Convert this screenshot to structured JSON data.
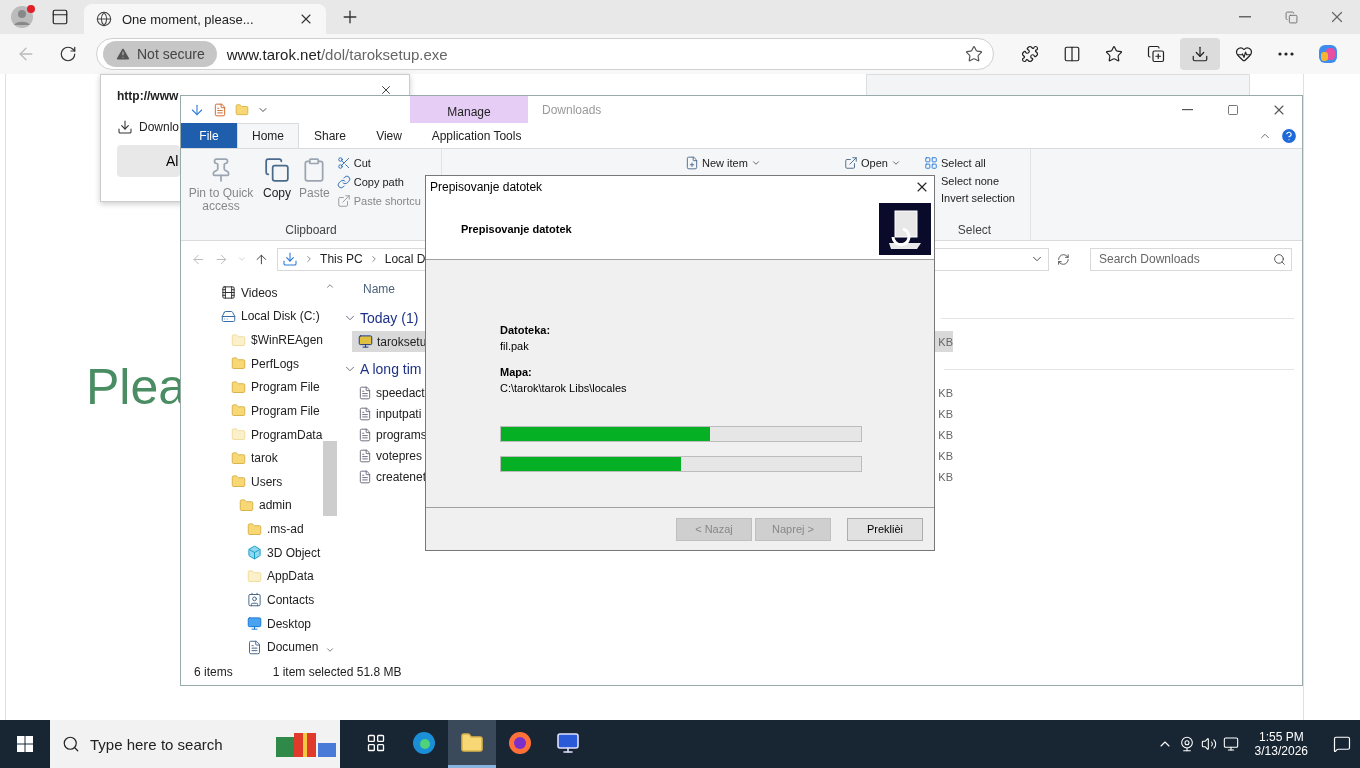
{
  "browser": {
    "tab_title": "One moment, please...",
    "security": "Not secure",
    "url_host": "www.tarok.net",
    "url_path": "/dol/taroksetup.exe",
    "page_heading": "Plea",
    "download_prompt": {
      "title": "http://www",
      "item": "Downlo",
      "button": "Al"
    }
  },
  "explorer": {
    "title": "Downloads",
    "context_tab": "Manage",
    "tabs": [
      {
        "label": "File",
        "kind": "file",
        "selected": false
      },
      {
        "label": "Home",
        "kind": "plain",
        "selected": true
      },
      {
        "label": "Share",
        "kind": "plain",
        "selected": false
      },
      {
        "label": "View",
        "kind": "plain",
        "selected": false
      },
      {
        "label": "Application Tools",
        "kind": "context",
        "selected": false
      }
    ],
    "clipboard": {
      "label": "Clipboard",
      "large": [
        {
          "label": "Pin to Quick access",
          "kind": "pin",
          "disabled": true
        },
        {
          "label": "Copy",
          "kind": "copy",
          "disabled": false
        },
        {
          "label": "Paste",
          "kind": "paste",
          "disabled": true
        }
      ],
      "small": [
        {
          "label": "Cut",
          "kind": "cut",
          "disabled": false
        },
        {
          "label": "Copy path",
          "kind": "path",
          "disabled": false
        },
        {
          "label": "Paste shortcu",
          "kind": "shortcut",
          "disabled": true
        }
      ]
    },
    "new_item": "New item",
    "open": "Open",
    "select": {
      "label": "Select",
      "items": [
        "Select all",
        "Select none",
        "Invert selection"
      ]
    },
    "path": [
      "This PC",
      "Local D"
    ],
    "search": {
      "placeholder": "Search Downloads"
    },
    "nav": [
      {
        "label": "Videos",
        "kind": "videos"
      },
      {
        "label": "Local Disk (C:)",
        "kind": "drive",
        "children": [
          {
            "label": "$WinREAgen",
            "kind": "faded"
          },
          {
            "label": "PerfLogs",
            "kind": "folder"
          },
          {
            "label": "Program File",
            "kind": "folder"
          },
          {
            "label": "Program File",
            "kind": "folder"
          },
          {
            "label": "ProgramData",
            "kind": "faded"
          },
          {
            "label": "tarok",
            "kind": "folder"
          },
          {
            "label": "Users",
            "kind": "folder",
            "children": [
              {
                "label": "admin",
                "kind": "folder",
                "children": [
                  {
                    "label": ".ms-ad",
                    "kind": "folder"
                  },
                  {
                    "label": "3D Object",
                    "kind": "cube"
                  },
                  {
                    "label": "AppData",
                    "kind": "faded"
                  },
                  {
                    "label": "Contacts",
                    "kind": "contacts"
                  },
                  {
                    "label": "Desktop",
                    "kind": "desktop"
                  },
                  {
                    "label": "Documen",
                    "kind": "document"
                  }
                ]
              }
            ]
          }
        ]
      }
    ],
    "column": "Name",
    "groups": [
      {
        "label": "Today (1)",
        "files": [
          {
            "name": "taroksetu",
            "size": "KB",
            "kind": "app",
            "selected": true
          }
        ]
      },
      {
        "label": "A long tim",
        "files": [
          {
            "name": "speedact",
            "size": "KB",
            "kind": "doc",
            "selected": false
          },
          {
            "name": "inputpati",
            "size": "KB",
            "kind": "doc",
            "selected": false
          },
          {
            "name": "programs",
            "size": "KB",
            "kind": "doc",
            "selected": false
          },
          {
            "name": "votepres",
            "size": "KB",
            "kind": "doc",
            "selected": false
          },
          {
            "name": "createnet",
            "size": "KB",
            "kind": "doc",
            "selected": false
          }
        ]
      }
    ],
    "status": {
      "count": "6 items",
      "selection": "1 item selected  51.8 MB"
    }
  },
  "dialog": {
    "title": "Prepisovanje datotek",
    "heading": "Prepisovanje datotek",
    "fields": [
      {
        "label": "Datoteka:",
        "value": "fil.pak"
      },
      {
        "label": "Mapa:",
        "value": "C:\\tarok\\tarok Libs\\locales"
      }
    ],
    "progress": [
      {
        "level": 0.58
      },
      {
        "level": 0.5
      }
    ],
    "buttons": [
      {
        "label": "< Nazaj",
        "disabled": true
      },
      {
        "label": "Naprej >",
        "disabled": true
      },
      {
        "label": "Preklièi",
        "disabled": false
      }
    ]
  },
  "taskbar": {
    "search_placeholder": "Type here to search",
    "apps": [
      {
        "kind": "taskview",
        "selected": false
      },
      {
        "kind": "edge",
        "selected": false
      },
      {
        "kind": "explorer",
        "selected": true
      },
      {
        "kind": "firefox",
        "selected": false
      },
      {
        "kind": "setup",
        "selected": false
      }
    ],
    "time": "1:55 PM",
    "date": "3/13/2026"
  }
}
